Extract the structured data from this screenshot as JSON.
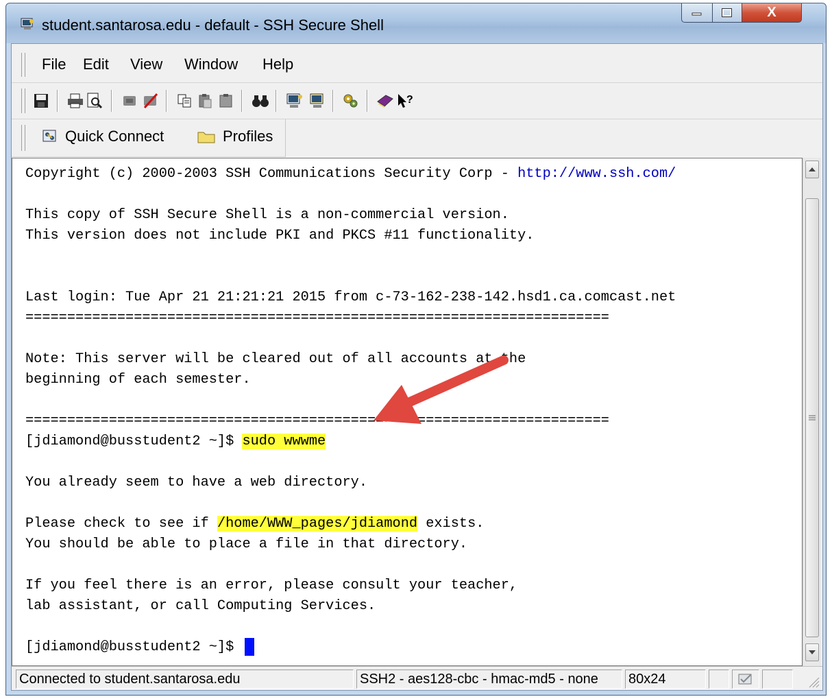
{
  "window": {
    "title": "student.santarosa.edu - default - SSH Secure Shell",
    "close_label": "X"
  },
  "menu": [
    "File",
    "Edit",
    "View",
    "Window",
    "Help"
  ],
  "quickbar": {
    "quick_connect": "Quick Connect",
    "profiles": "Profiles"
  },
  "terminal": {
    "copyright_prefix": "Copyright (c) 2000-2003 SSH Communications Security Corp - ",
    "copyright_link": "http://www.ssh.com/",
    "line_noncommercial": "This copy of SSH Secure Shell is a non-commercial version.",
    "line_pki": "This version does not include PKI and PKCS #11 functionality.",
    "line_last_login": "Last login: Tue Apr 21 21:21:21 2015 from c-73-162-238-142.hsd1.ca.comcast.net",
    "separator": "======================================================================",
    "line_note_1": "Note: This server will be cleared out of all accounts at the",
    "line_note_2": "beginning of each semester.",
    "prompt": "[jdiamond@busstudent2 ~]$ ",
    "command": "sudo wwwme",
    "line_already": "You already seem to have a web directory.",
    "line_check_prefix": "Please check to see if ",
    "path": "/home/WWW_pages/jdiamond",
    "line_check_suffix": " exists.",
    "line_place": "You should be able to place a file in that directory.",
    "line_error_1": "If you feel there is an error, please consult your teacher,",
    "line_error_2": "lab assistant, or call Computing Services."
  },
  "status": {
    "connection": "Connected to student.santarosa.edu",
    "cipher": "SSH2 - aes128-cbc - hmac-md5 - none",
    "size": "80x24"
  },
  "colors": {
    "highlight": "#ffff3a",
    "annotation_arrow": "#e0473f",
    "link": "#0000c0",
    "cursor": "#0010ff"
  }
}
